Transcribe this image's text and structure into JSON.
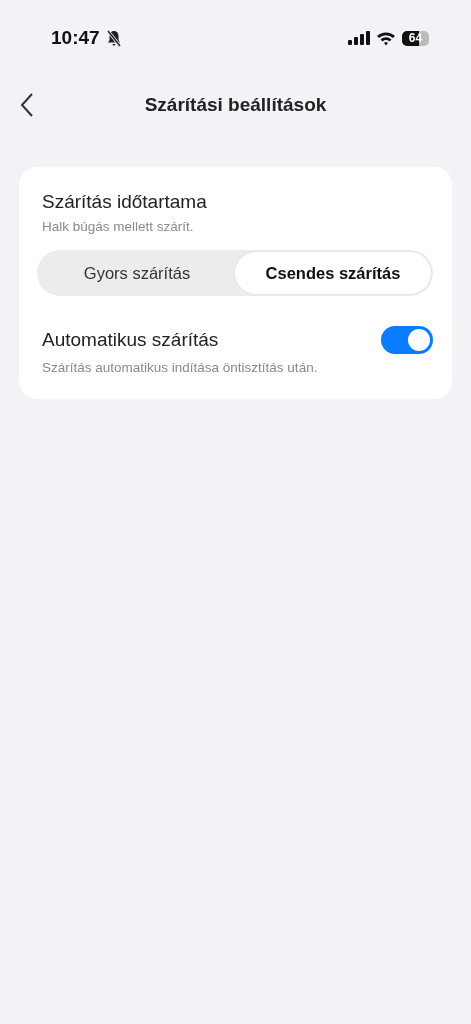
{
  "status_bar": {
    "time": "10:47",
    "battery": "64"
  },
  "header": {
    "title": "Szárítási beállítások"
  },
  "duration": {
    "title": "Szárítás időtartama",
    "description": "Halk búgás mellett szárít.",
    "options": [
      {
        "label": "Gyors szárítás",
        "selected": false
      },
      {
        "label": "Csendes szárítás",
        "selected": true
      }
    ]
  },
  "auto_dry": {
    "title": "Automatikus szárítás",
    "description": "Szárítás automatikus indítása öntisztítás után.",
    "on": true
  }
}
